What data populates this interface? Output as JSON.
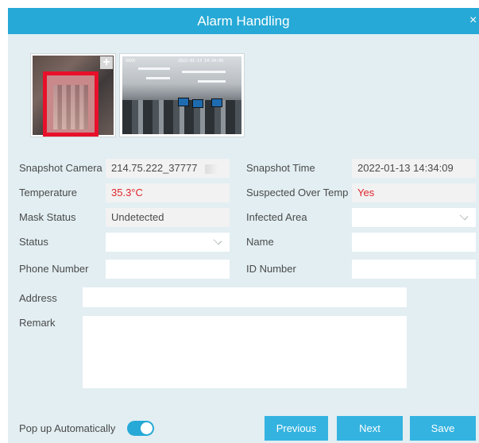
{
  "dialog": {
    "title": "Alarm Handling",
    "close_glyph": "×",
    "add_glyph": "+"
  },
  "scene": {
    "stamp_left": "XXXX",
    "stamp_right": "2022-01-13 14:34:09"
  },
  "fields": {
    "snapshot_camera": {
      "label": "Snapshot Camera",
      "value": "214.75.222_37777"
    },
    "snapshot_time": {
      "label": "Snapshot Time",
      "value": "2022-01-13 14:34:09"
    },
    "temperature": {
      "label": "Temperature",
      "value": "35.3°C"
    },
    "suspected_over_temp": {
      "label": "Suspected Over Temp",
      "value": "Yes"
    },
    "mask_status": {
      "label": "Mask Status",
      "value": "Undetected"
    },
    "infected_area": {
      "label": "Infected Area",
      "value": ""
    },
    "status": {
      "label": "Status",
      "value": ""
    },
    "name": {
      "label": "Name",
      "value": ""
    },
    "phone_number": {
      "label": "Phone Number",
      "value": ""
    },
    "id_number": {
      "label": "ID Number",
      "value": ""
    },
    "address": {
      "label": "Address",
      "value": ""
    },
    "remark": {
      "label": "Remark",
      "value": ""
    }
  },
  "footer": {
    "popup_label": "Pop up Automatically",
    "popup_enabled": true,
    "previous_label": "Previous",
    "next_label": "Next",
    "save_label": "Save"
  },
  "colors": {
    "accent": "#26a9d6",
    "button": "#34b3e0",
    "panel": "#e2eef2",
    "alert_text": "#e0252b"
  },
  "icons": {
    "close": "close-icon",
    "add": "plus-icon",
    "dropdown": "chevron-down-icon"
  }
}
